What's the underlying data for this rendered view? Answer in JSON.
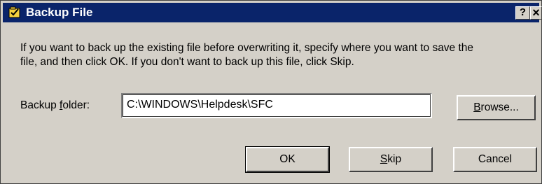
{
  "window": {
    "title": "Backup File",
    "help_label": "?",
    "close_label": "×"
  },
  "message": {
    "line1": "If you want to back up the existing file before overwriting it, specify where you want to save the",
    "line2": "file, and then click OK. If you don't want to back up this file, click Skip."
  },
  "backup_folder": {
    "label_before": "Backup ",
    "label_underlined": "f",
    "label_after": "older:",
    "value": "C:\\WINDOWS\\Helpdesk\\SFC"
  },
  "buttons": {
    "browse_underlined": "B",
    "browse_rest": "rowse...",
    "ok": "OK",
    "skip_underlined": "S",
    "skip_rest": "kip",
    "cancel": "Cancel"
  },
  "colors": {
    "title_bar": "#0a246a",
    "face": "#d4d0c8",
    "title_text": "#ffffff"
  },
  "icons": {
    "app": "backup-file-icon"
  }
}
